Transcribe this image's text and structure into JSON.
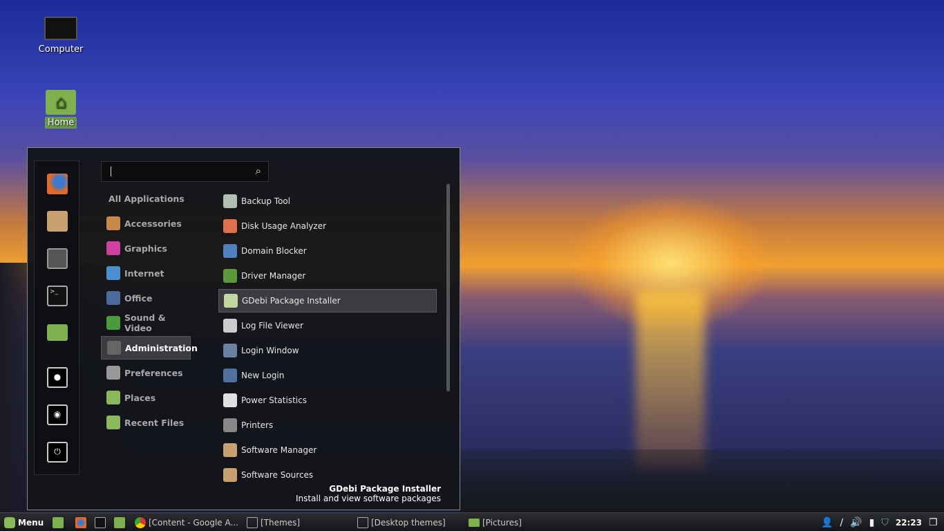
{
  "desktop": {
    "icons": [
      {
        "label": "Computer",
        "icon": "computer-icon"
      },
      {
        "label": "Home",
        "icon": "home-folder-icon"
      }
    ]
  },
  "menu": {
    "search": {
      "value": "",
      "placeholder": ""
    },
    "favorites": [
      {
        "icon": "firefox-icon"
      },
      {
        "icon": "software-manager-icon"
      },
      {
        "icon": "system-settings-icon"
      },
      {
        "icon": "terminal-icon"
      },
      {
        "icon": "files-folder-icon"
      },
      {
        "icon": "lock-screen-icon"
      },
      {
        "icon": "logout-icon"
      },
      {
        "icon": "power-icon"
      }
    ],
    "categories": [
      {
        "label": "All Applications",
        "color": ""
      },
      {
        "label": "Accessories",
        "color": "#c8884a"
      },
      {
        "label": "Graphics",
        "color": "#d040a0"
      },
      {
        "label": "Internet",
        "color": "#4a90d0"
      },
      {
        "label": "Office",
        "color": "#4a6a9a"
      },
      {
        "label": "Sound & Video",
        "color": "#4a9a3a"
      },
      {
        "label": "Administration",
        "color": "#666",
        "selected": true
      },
      {
        "label": "Preferences",
        "color": "#999"
      },
      {
        "label": "Places",
        "color": "#8ab85a"
      },
      {
        "label": "Recent Files",
        "color": "#8ab85a"
      }
    ],
    "apps": [
      {
        "label": "Backup Tool",
        "color": "#b0c0b0"
      },
      {
        "label": "Disk Usage Analyzer",
        "color": "#e07050"
      },
      {
        "label": "Domain Blocker",
        "color": "#5080c0"
      },
      {
        "label": "Driver Manager",
        "color": "#5a9a3a"
      },
      {
        "label": "GDebi Package Installer",
        "color": "#c0d8a0",
        "selected": true
      },
      {
        "label": "Log File Viewer",
        "color": "#ccc"
      },
      {
        "label": "Login Window",
        "color": "#6a80a0"
      },
      {
        "label": "New Login",
        "color": "#5070a0"
      },
      {
        "label": "Power Statistics",
        "color": "#e0e0e0"
      },
      {
        "label": "Printers",
        "color": "#888"
      },
      {
        "label": "Software Manager",
        "color": "#c8a070"
      },
      {
        "label": "Software Sources",
        "color": "#c8a070"
      }
    ],
    "description": {
      "title": "GDebi Package Installer",
      "text": "Install and view software packages"
    }
  },
  "taskbar": {
    "menu_label": "Menu",
    "windows": [
      "[Content - Google A...",
      "[Themes]",
      "[Desktop themes]",
      "[Pictures]"
    ],
    "clock": "22:23",
    "accent": "#8ab85a"
  }
}
